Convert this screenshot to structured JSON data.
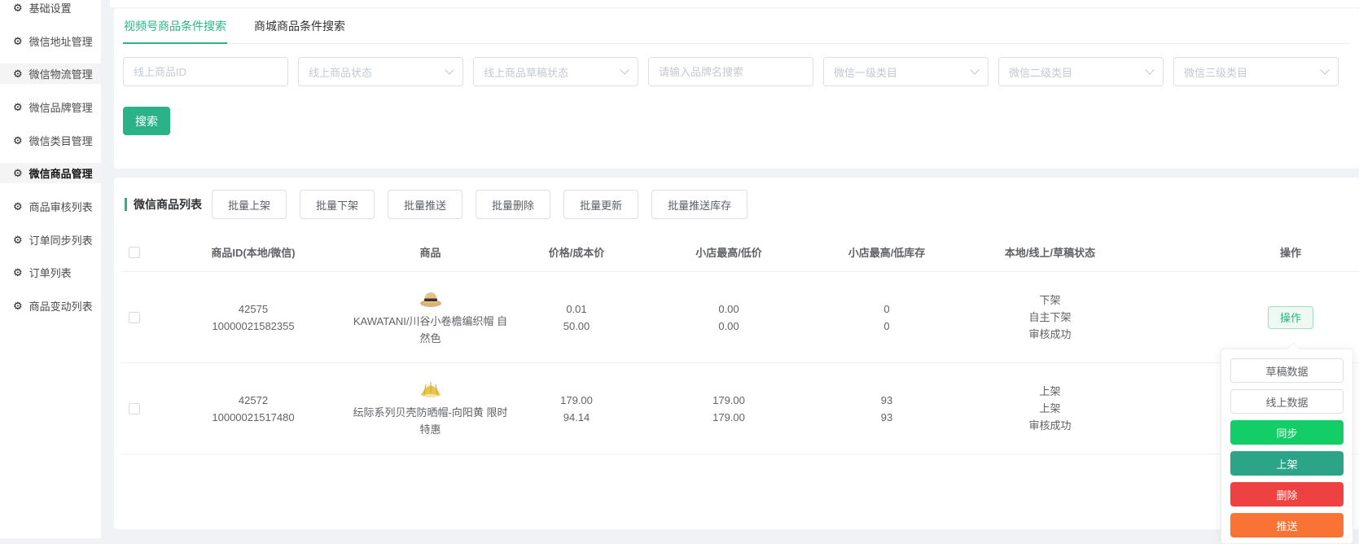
{
  "colors": {
    "accent_green": "#2bb387",
    "sync_green": "#13ce66",
    "onshelf_teal": "#2ba487",
    "delete_red": "#ee4242",
    "push_orange": "#f97434"
  },
  "sidebar": {
    "items": [
      {
        "label": "基础设置"
      },
      {
        "label": "微信地址管理"
      },
      {
        "label": "微信物流管理"
      },
      {
        "label": "微信品牌管理"
      },
      {
        "label": "微信类目管理"
      },
      {
        "label": "微信商品管理"
      },
      {
        "label": "商品审核列表"
      },
      {
        "label": "订单同步列表"
      },
      {
        "label": "订单列表"
      },
      {
        "label": "商品变动列表"
      }
    ]
  },
  "tabs": [
    {
      "label": "视频号商品条件搜索",
      "active": true
    },
    {
      "label": "商城商品条件搜索",
      "active": false
    }
  ],
  "filters": [
    {
      "type": "input",
      "placeholder": "线上商品ID"
    },
    {
      "type": "select",
      "placeholder": "线上商品状态"
    },
    {
      "type": "select",
      "placeholder": "线上商品草稿状态"
    },
    {
      "type": "input",
      "placeholder": "请输入品牌名搜索"
    },
    {
      "type": "select",
      "placeholder": "微信一级类目"
    },
    {
      "type": "select",
      "placeholder": "微信二级类目"
    },
    {
      "type": "select",
      "placeholder": "微信三级类目"
    }
  ],
  "search_button": "搜索",
  "list": {
    "title": "微信商品列表",
    "batch_buttons": [
      "批量上架",
      "批量下架",
      "批量推送",
      "批量删除",
      "批量更新",
      "批量推送库存"
    ],
    "columns": [
      "商品ID(本地/微信)",
      "商品",
      "价格/成本价",
      "小店最高/低价",
      "小店最高/低库存",
      "本地/线上/草稿状态",
      "操作"
    ],
    "action_button_label": "操作",
    "rows": [
      {
        "id_local": "42575",
        "id_wechat": "10000021582355",
        "name": "KAWATANI/川谷小卷檐编织帽 自然色",
        "price": "0.01",
        "cost": "50.00",
        "shop_high_price": "0.00",
        "shop_low_price": "0.00",
        "shop_high_stock": "0",
        "shop_low_stock": "0",
        "status_local": "下架",
        "status_online": "自主下架",
        "status_draft": "审核成功"
      },
      {
        "id_local": "42572",
        "id_wechat": "10000021517480",
        "name": "纭际系列贝壳防晒帽-向阳黄 限时特惠",
        "price": "179.00",
        "cost": "94.14",
        "shop_high_price": "179.00",
        "shop_low_price": "179.00",
        "shop_high_stock": "93",
        "shop_low_stock": "93",
        "status_local": "上架",
        "status_online": "上架",
        "status_draft": "审核成功"
      }
    ]
  },
  "action_menu": {
    "items": [
      {
        "label": "草稿数据",
        "style": "plain"
      },
      {
        "label": "线上数据",
        "style": "plain"
      },
      {
        "label": "同步",
        "style": "green"
      },
      {
        "label": "上架",
        "style": "teal"
      },
      {
        "label": "删除",
        "style": "red"
      },
      {
        "label": "推送",
        "style": "orange"
      }
    ]
  }
}
